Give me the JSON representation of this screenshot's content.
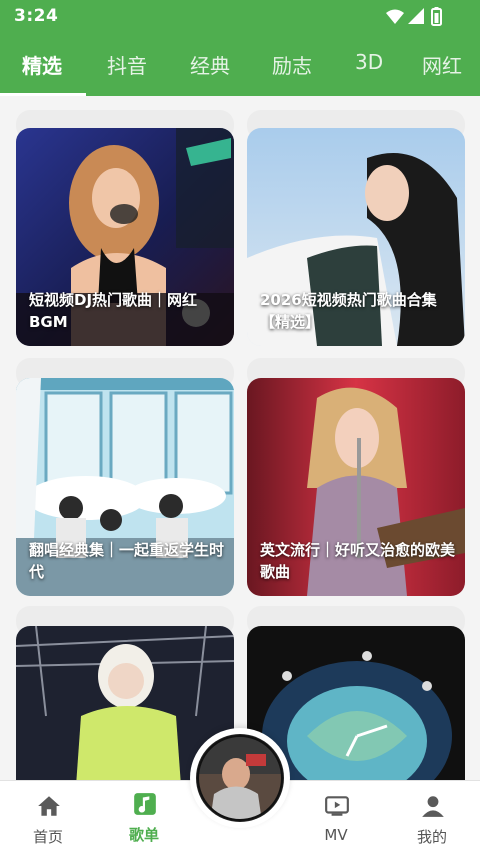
{
  "status": {
    "time": "3:24"
  },
  "tabs": [
    {
      "label": "精选",
      "active": true
    },
    {
      "label": "抖音"
    },
    {
      "label": "经典"
    },
    {
      "label": "励志"
    },
    {
      "label": "3D"
    },
    {
      "label": "网红"
    }
  ],
  "playlists": [
    {
      "title": "短视频DJ热门歌曲｜网红BGM"
    },
    {
      "title": "2026短视频热门歌曲合集【精选】"
    },
    {
      "title": "翻唱经典集｜一起重返学生时代"
    },
    {
      "title": "英文流行｜好听又治愈的欧美歌曲"
    },
    {
      "title": ""
    },
    {
      "title": ""
    }
  ],
  "bottom_nav": [
    {
      "label": "首页",
      "icon": "home-icon"
    },
    {
      "label": "歌单",
      "icon": "playlist-icon",
      "active": true
    },
    {
      "label": "MV",
      "icon": "tv-icon"
    },
    {
      "label": "我的",
      "icon": "user-icon"
    }
  ],
  "now_playing": {
    "icon": "album-disc-icon"
  },
  "colors": {
    "accent": "#4fae4f",
    "background": "#f4f4f4"
  }
}
